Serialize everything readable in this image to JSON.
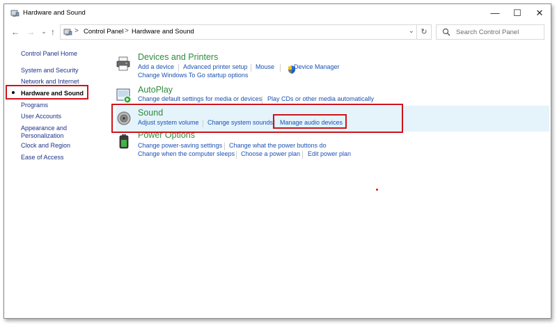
{
  "window": {
    "title": "Hardware and Sound",
    "minimize_glyph": "—",
    "maximize_glyph": "☐",
    "close_glyph": "✕"
  },
  "address": {
    "back_glyph": "←",
    "forward_glyph": "→",
    "recent_glyph": "⌄",
    "up_glyph": "↑",
    "crumbs": [
      "Control Panel",
      "Hardware and Sound"
    ],
    "separator": ">",
    "dropdown_glyph": "⌄",
    "refresh_glyph": "↻",
    "search_placeholder": "Search Control Panel"
  },
  "sidebar": {
    "items": [
      {
        "label": "Control Panel Home",
        "current": false
      },
      {
        "label": "System and Security",
        "current": false
      },
      {
        "label": "Network and Internet",
        "current": false
      },
      {
        "label": "Hardware and Sound",
        "current": true
      },
      {
        "label": "Programs",
        "current": false
      },
      {
        "label": "User Accounts",
        "current": false
      },
      {
        "label": "Appearance and",
        "current": false
      },
      {
        "label": "Personalization",
        "current": false
      },
      {
        "label": "Clock and Region",
        "current": false
      },
      {
        "label": "Ease of Access",
        "current": false
      }
    ]
  },
  "categories": [
    {
      "title": "Devices and Printers",
      "icon": "printer-icon",
      "links": [
        [
          "Add a device",
          "Advanced printer setup",
          "Mouse",
          "Device Manager"
        ],
        [
          "Change Windows To Go startup options"
        ]
      ]
    },
    {
      "title": "AutoPlay",
      "icon": "autoplay-icon",
      "links": [
        [
          "Change default settings for media or devices",
          "Play CDs or other media automatically"
        ]
      ]
    },
    {
      "title": "Sound",
      "icon": "speaker-icon",
      "links": [
        [
          "Adjust system volume",
          "Change system sounds",
          "Manage audio devices"
        ]
      ]
    },
    {
      "title": "Power Options",
      "icon": "battery-icon",
      "links": [
        [
          "Change power-saving settings",
          "Change what the power buttons do"
        ],
        [
          "Change when the computer sleeps",
          "Choose a power plan",
          "Edit power plan"
        ]
      ]
    }
  ],
  "colors": {
    "category_title": "#2e8b3d",
    "link": "#1b51b3",
    "sidebar_link": "#1e3287",
    "hover_row": "#e5f3fb",
    "annotation_red": "#d0121a"
  }
}
